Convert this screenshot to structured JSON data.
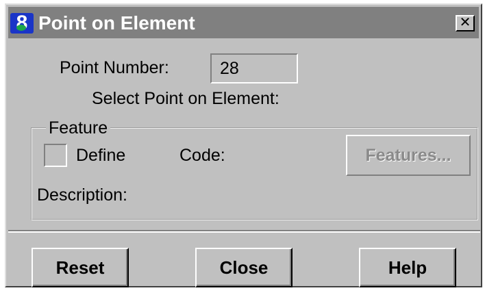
{
  "window": {
    "title": "Point on Element",
    "close_glyph": "✕"
  },
  "colors": {
    "titlebar": "#808080",
    "dialog_bg": "#c0c0c0",
    "icon_bg": "#1a35c8",
    "icon_accent": "#1fa64a",
    "disabled_text": "#8a8a8a"
  },
  "icons": {
    "app": "app-logo-icon",
    "close": "close-icon"
  },
  "point": {
    "label": "Point Number:",
    "value": "28",
    "instruction": "Select Point on Element:"
  },
  "feature": {
    "group_label": "Feature",
    "define_label": "Define",
    "define_checked": false,
    "code_label": "Code:",
    "features_button": "Features...",
    "features_enabled": false,
    "description_label": "Description:"
  },
  "buttons": {
    "reset": "Reset",
    "close": "Close",
    "help": "Help"
  }
}
